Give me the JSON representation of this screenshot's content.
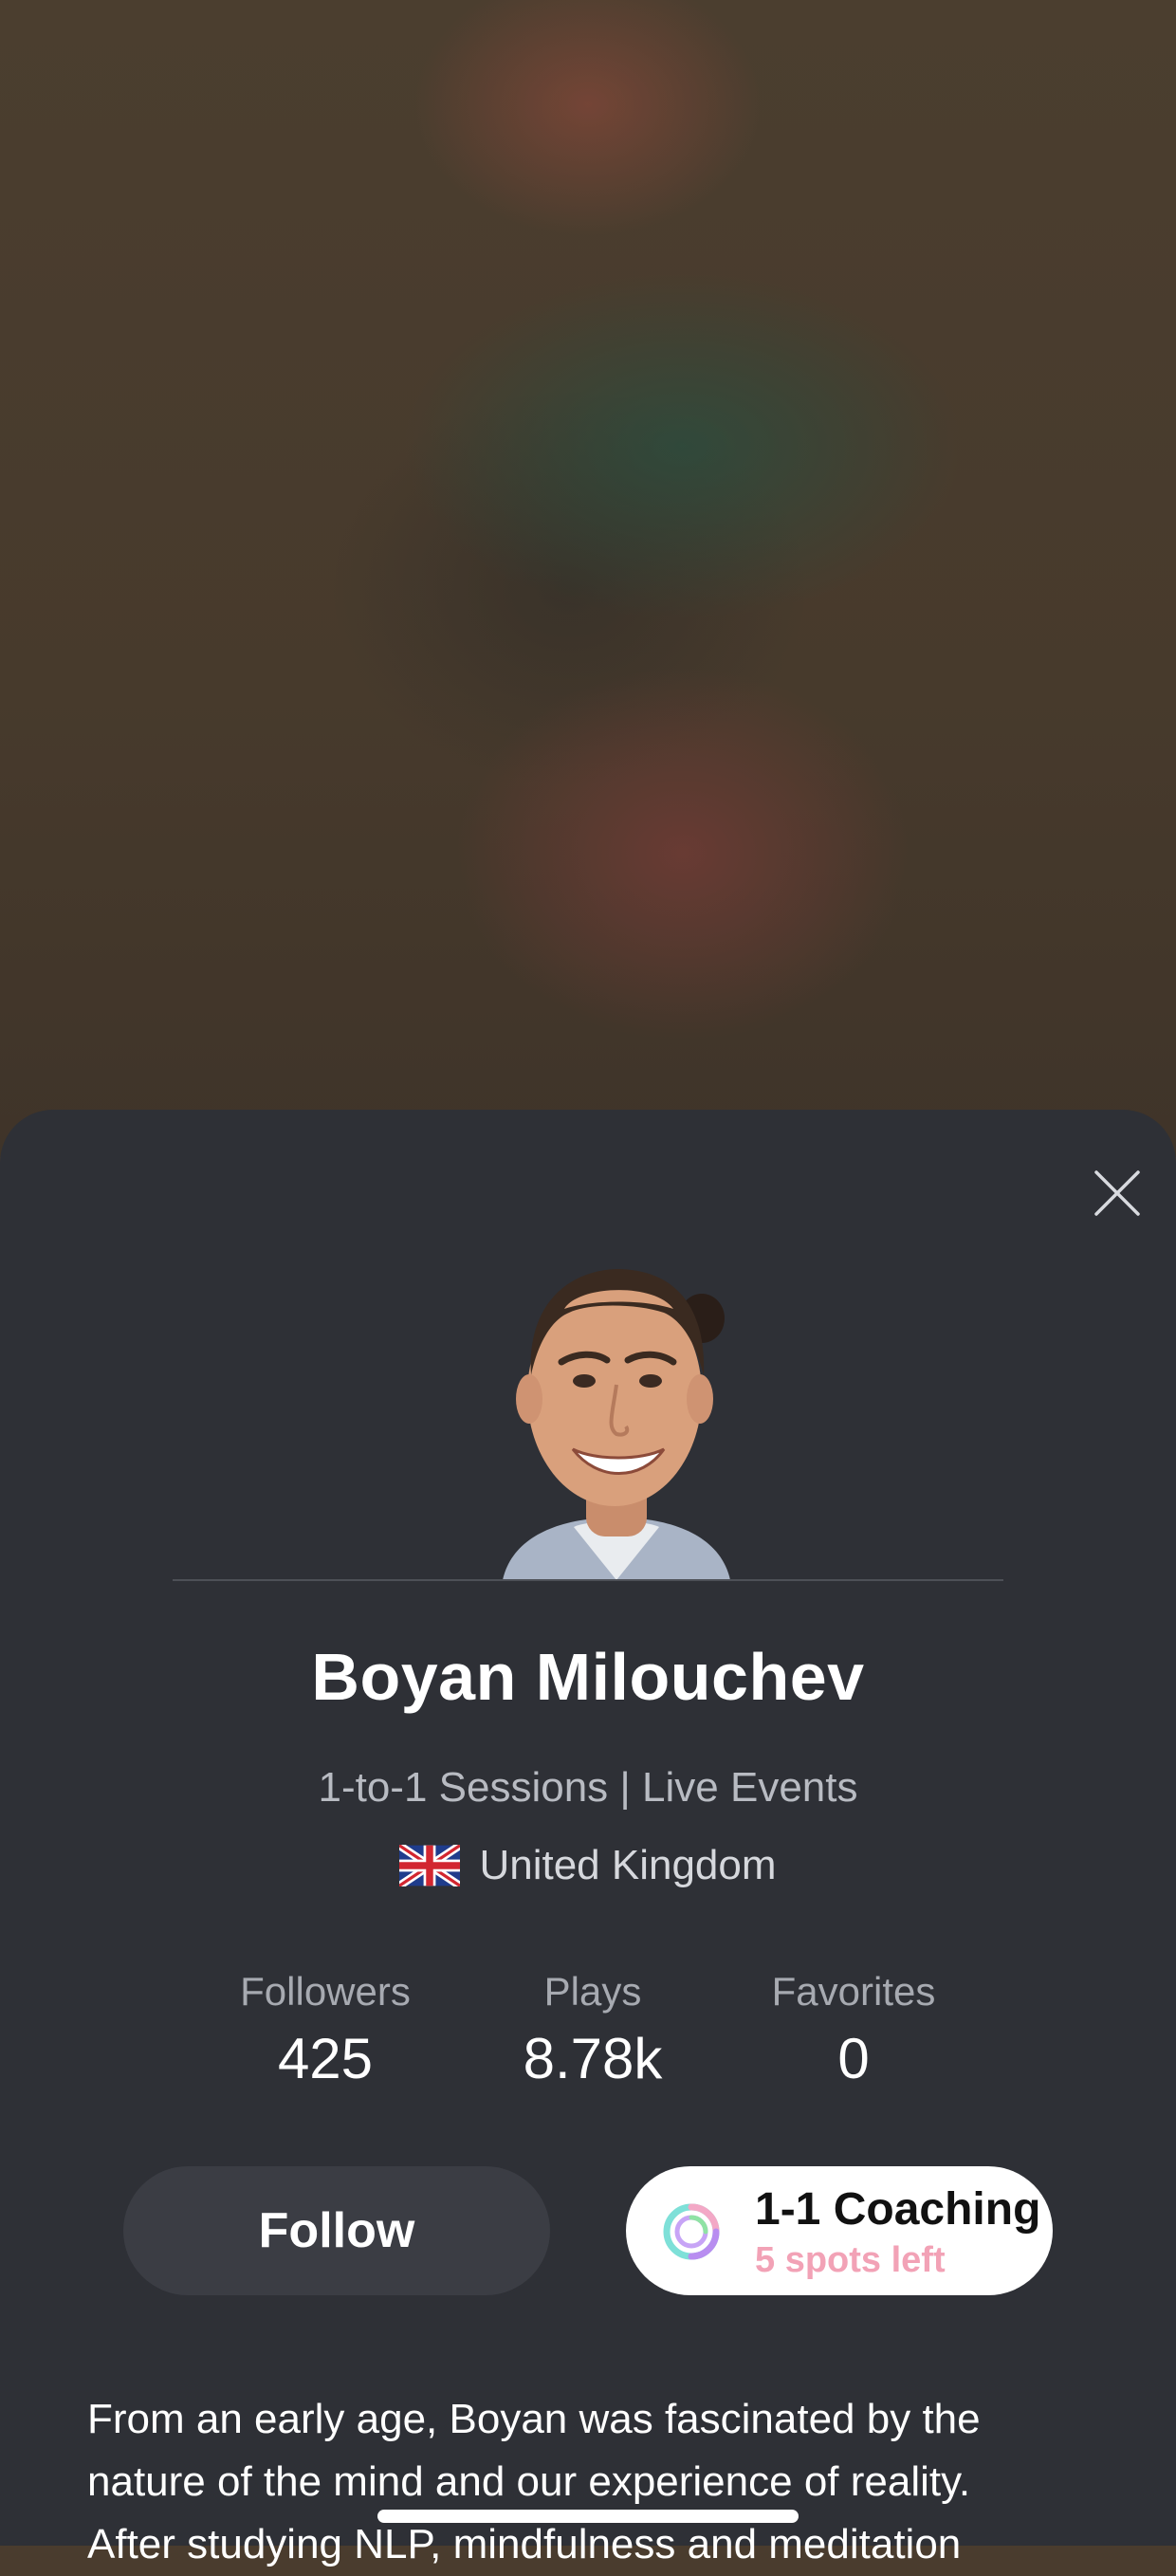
{
  "profile": {
    "name": "Boyan Milouchev",
    "subtitle": "1-to-1 Sessions | Live Events",
    "country": "United Kingdom",
    "flag_icon": "uk-flag-icon"
  },
  "stats": [
    {
      "label": "Followers",
      "value": "425"
    },
    {
      "label": "Plays",
      "value": "8.78k"
    },
    {
      "label": "Favorites",
      "value": "0"
    }
  ],
  "actions": {
    "follow_label": "Follow",
    "coaching_title": "1-1 Coaching",
    "coaching_subtitle": "5 spots left"
  },
  "bio": {
    "lines": [
      "From an early age, Boyan was fascinated by the",
      "nature of the mind and our experience of reality.",
      "After studying NLP, mindfulness and meditation"
    ]
  },
  "colors": {
    "sheet_background": "#2e3036",
    "follow_button": "#3b3d44",
    "coaching_accent": "#f2a2b6"
  },
  "icons": {
    "close": "close-icon",
    "coaching": "coaching-ring-icon"
  }
}
